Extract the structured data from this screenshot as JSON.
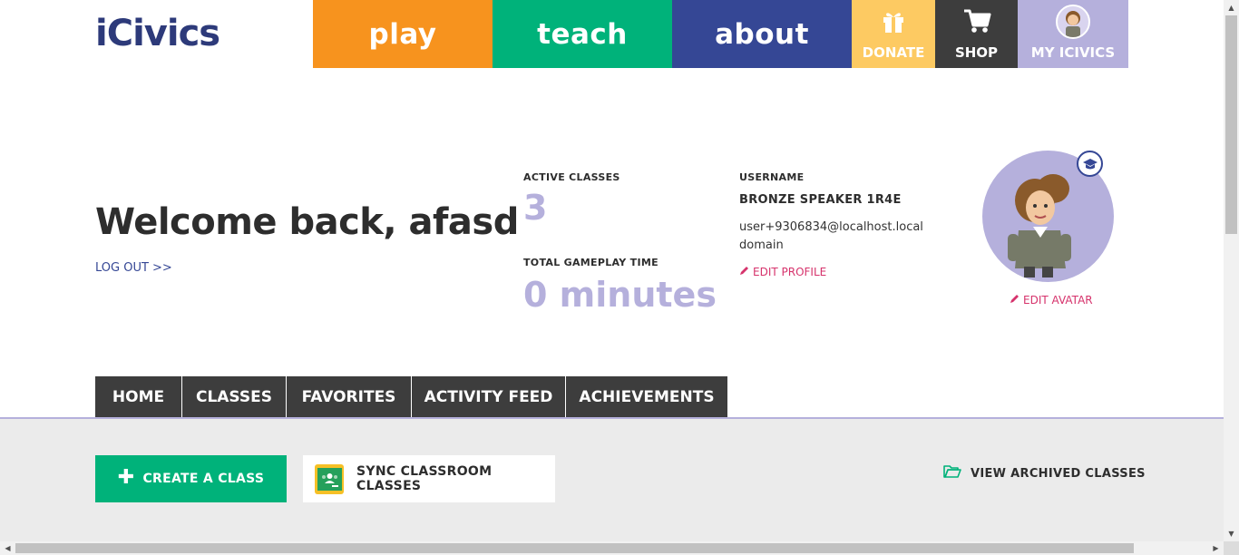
{
  "header": {
    "logo_text": "iCivics",
    "nav": {
      "play": "play",
      "teach": "teach",
      "about": "about"
    },
    "donate": "DONATE",
    "shop": "SHOP",
    "my_icivics": "MY ICIVICS"
  },
  "welcome": {
    "greeting": "Welcome back, afasd",
    "logout": "LOG OUT >>"
  },
  "stats": {
    "active_classes_label": "ACTIVE CLASSES",
    "active_classes_value": "3",
    "gameplay_label": "TOTAL GAMEPLAY TIME",
    "gameplay_value": "0 minutes"
  },
  "profile": {
    "username_label": "USERNAME",
    "username": "BRONZE SPEAKER 1R4E",
    "email": "user+9306834@localhost.localdomain",
    "edit_profile": "EDIT PROFILE",
    "edit_avatar": "EDIT AVATAR"
  },
  "tabs": [
    "HOME",
    "CLASSES",
    "FAVORITES",
    "ACTIVITY FEED",
    "ACHIEVEMENTS"
  ],
  "actions": {
    "create_class": "CREATE A CLASS",
    "sync_classroom": "SYNC CLASSROOM CLASSES",
    "view_archived": "VIEW ARCHIVED CLASSES"
  },
  "colors": {
    "play": "#f7931e",
    "teach": "#00b27a",
    "about": "#354795",
    "donate": "#fdca62",
    "shop": "#3d3d3d",
    "my_icivics": "#b5b0dc",
    "accent_link": "#d6336c"
  },
  "icons": [
    "gift-icon",
    "cart-icon",
    "pencil-icon",
    "graduation-cap-icon",
    "google-classroom-icon",
    "folder-open-icon",
    "plus-icon"
  ]
}
